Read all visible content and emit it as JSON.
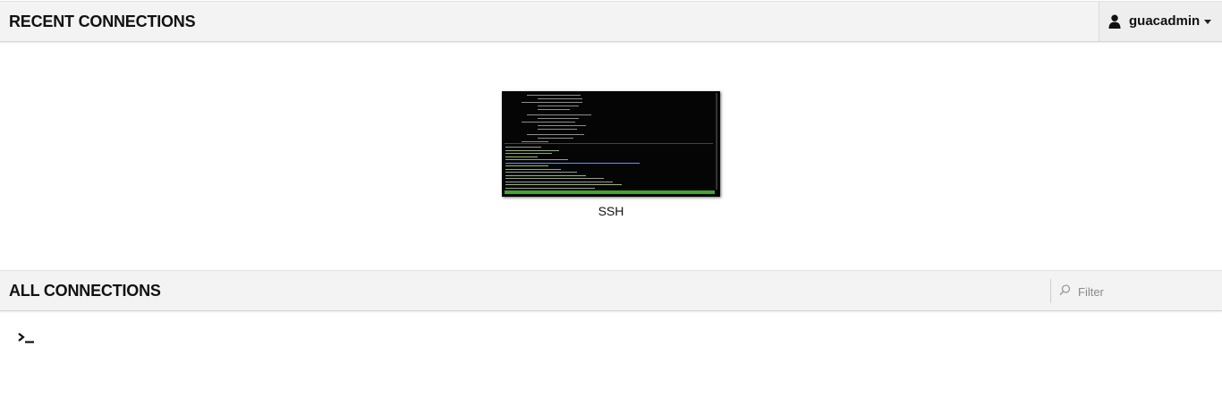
{
  "recent": {
    "title": "RECENT CONNECTIONS",
    "connections": [
      {
        "name": "SSH",
        "thumbnail": "terminal-session"
      }
    ]
  },
  "user_menu": {
    "username": "guacadmin",
    "icon": "user-icon",
    "dropdown_icon": "caret-down-icon"
  },
  "all": {
    "title": "ALL CONNECTIONS",
    "filter": {
      "placeholder": "Filter",
      "value": "",
      "icon": "search-icon"
    },
    "connections": [
      {
        "icon": "terminal-icon",
        "name": ""
      }
    ]
  },
  "colors": {
    "header_bg": "#f3f3f3",
    "terminal_bg": "#050505",
    "terminal_status_bar": "#4c9f38"
  }
}
